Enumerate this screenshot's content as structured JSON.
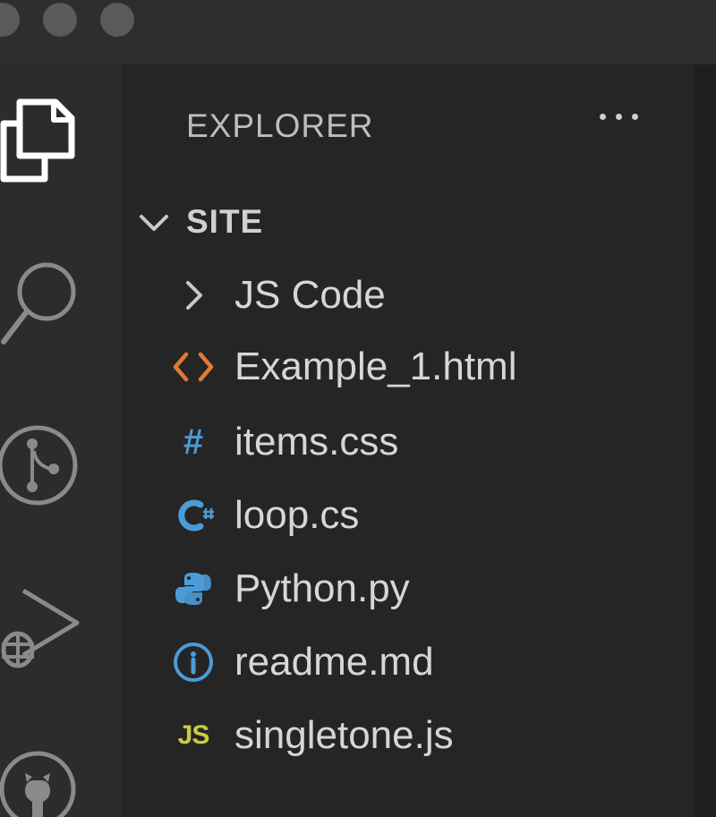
{
  "explorer": {
    "title": "EXPLORER",
    "more_actions_icon": "ellipsis-icon"
  },
  "workspace": {
    "name": "SITE",
    "expanded": true
  },
  "tree": {
    "items": [
      {
        "name": "JS Code",
        "type": "folder",
        "icon": "chevron-right-icon"
      },
      {
        "name": "Example_1.html",
        "type": "file",
        "icon": "html-icon",
        "icon_color": "#e37933"
      },
      {
        "name": "items.css",
        "type": "file",
        "icon": "css-icon",
        "icon_glyph": "#",
        "icon_color": "#4c9bd6"
      },
      {
        "name": "loop.cs",
        "type": "file",
        "icon": "csharp-icon",
        "icon_color": "#4c9bd6"
      },
      {
        "name": "Python.py",
        "type": "file",
        "icon": "python-icon",
        "icon_color": "#4c9bd6"
      },
      {
        "name": "readme.md",
        "type": "file",
        "icon": "info-icon",
        "icon_color": "#4c9bd6"
      },
      {
        "name": "singletone.js",
        "type": "file",
        "icon": "js-icon",
        "icon_glyph": "JS",
        "icon_color": "#cbcb41"
      }
    ]
  },
  "activity_bar": {
    "icons": [
      "files-icon",
      "search-icon",
      "source-control-icon",
      "run-debug-icon",
      "github-icon"
    ]
  },
  "colors": {
    "sidebar_bg": "#252526",
    "activity_bg": "#2c2c2c",
    "text": "#d6d6d6"
  }
}
